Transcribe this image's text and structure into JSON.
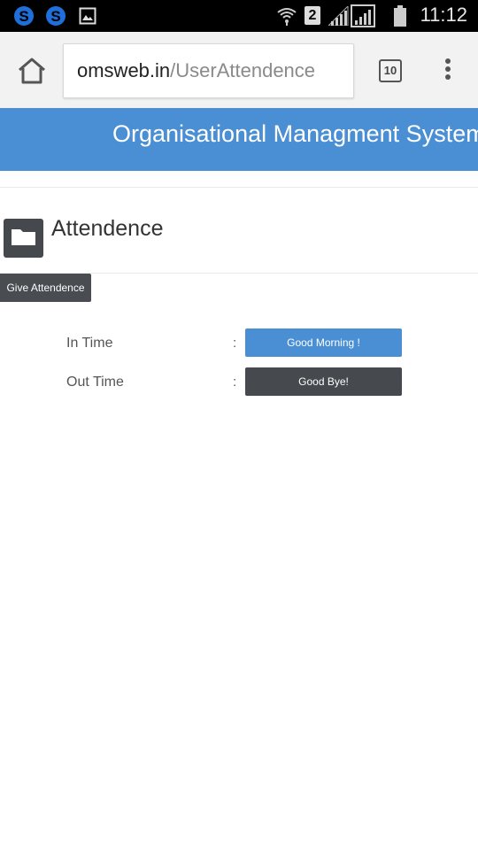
{
  "status_bar": {
    "time": "11:12",
    "sim_slot": "2",
    "icons": [
      "skype-icon",
      "skype-icon",
      "image-icon",
      "wifi-icon",
      "sim-2-icon",
      "signal-icon",
      "signal-icon",
      "battery-icon"
    ]
  },
  "browser": {
    "url_domain": "omsweb.in",
    "url_path": "/UserAttendence",
    "tab_count": "10",
    "icons": [
      "home-icon",
      "tabs-icon",
      "more-vert-icon"
    ]
  },
  "app": {
    "title": "Organisational Managment System"
  },
  "page": {
    "title": "Attendence",
    "give_button": "Give Attendence"
  },
  "attendance": {
    "rows": [
      {
        "label": "In Time",
        "separator": ":",
        "button": "Good Morning !"
      },
      {
        "label": "Out Time",
        "separator": ":",
        "button": "Good Bye!"
      }
    ]
  },
  "colors": {
    "header": "#4a8fd4",
    "primary_button": "#4a8fd4",
    "dark_button": "#46494d"
  }
}
